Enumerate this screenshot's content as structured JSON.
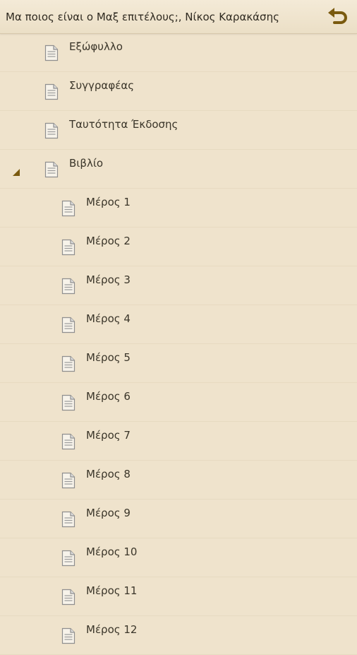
{
  "header": {
    "title": "Μα ποιος είναι ο Μαξ επιτέλους;, Νίκος Καρακάσης",
    "back_icon": "undo-arrow-icon",
    "accent": "#7a5a0f"
  },
  "toc": {
    "top_items": [
      {
        "label": "Εξώφυλλο"
      },
      {
        "label": "Συγγραφέας"
      },
      {
        "label": "Ταυτότητα Έκδοσης"
      },
      {
        "label": "Βιβλίο",
        "expanded": true
      }
    ],
    "book_parts": [
      {
        "label": "Μέρος 1"
      },
      {
        "label": "Μέρος 2"
      },
      {
        "label": "Μέρος 3"
      },
      {
        "label": "Μέρος 4"
      },
      {
        "label": "Μέρος 5"
      },
      {
        "label": "Μέρος 6"
      },
      {
        "label": "Μέρος 7"
      },
      {
        "label": "Μέρος 8"
      },
      {
        "label": "Μέρος 9"
      },
      {
        "label": "Μέρος 10"
      },
      {
        "label": "Μέρος 11"
      },
      {
        "label": "Μέρος 12"
      }
    ]
  }
}
